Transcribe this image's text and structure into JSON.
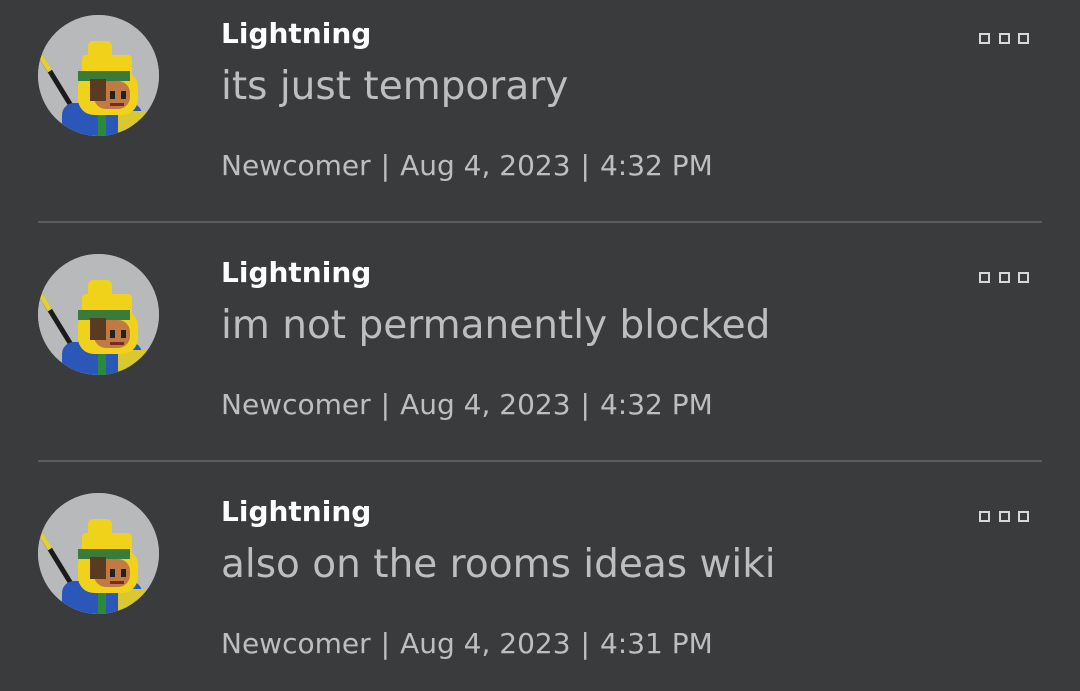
{
  "comments": [
    {
      "username": "Lightning",
      "message": "its just temporary",
      "rank": "Newcomer",
      "date": "Aug 4, 2023",
      "time": "4:32 PM",
      "separator": "|",
      "more_icon": "more-options-icon",
      "avatar_icon": "avatar-icon"
    },
    {
      "username": "Lightning",
      "message": "im not permanently blocked",
      "rank": "Newcomer",
      "date": "Aug 4, 2023",
      "time": "4:32 PM",
      "separator": "|",
      "more_icon": "more-options-icon",
      "avatar_icon": "avatar-icon"
    },
    {
      "username": "Lightning",
      "message": "also on the rooms ideas wiki",
      "rank": "Newcomer",
      "date": "Aug 4, 2023",
      "time": "4:31 PM",
      "separator": "|",
      "more_icon": "more-options-icon",
      "avatar_icon": "avatar-icon"
    }
  ],
  "colors": {
    "background": "#393b3d",
    "username": "#ffffff",
    "body_text": "#bdbebe",
    "divider": "#5a5c5e",
    "avatar_bg": "#b8b9ba"
  }
}
